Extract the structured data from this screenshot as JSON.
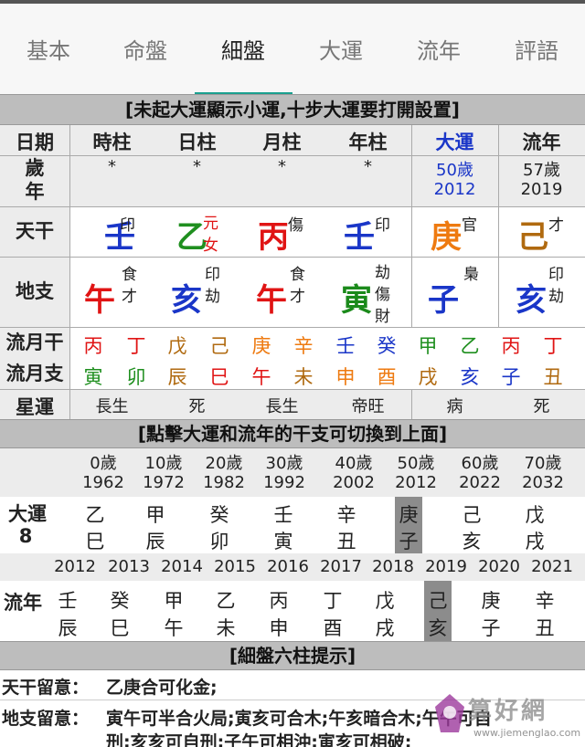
{
  "tabs": [
    "基本",
    "命盤",
    "細盤",
    "大運",
    "流年",
    "評語"
  ],
  "header1": "[未起大運顯示小運,十步大運要打開設置]",
  "columns": {
    "c0": "日期",
    "c1": "時柱",
    "c2": "日柱",
    "c3": "月柱",
    "c4": "年柱",
    "c5": "大運",
    "c6": "流年"
  },
  "age_row": {
    "label": "歲\n年",
    "c1": "*",
    "c2": "*",
    "c3": "*",
    "c4": "*",
    "c5_age": "50歲",
    "c5_year": "2012",
    "c6_age": "57歲",
    "c6_year": "2019"
  },
  "tiangan": {
    "label": "天干",
    "c1": "壬",
    "c1_sup": "印",
    "c2": "乙",
    "c2_sup1": "元",
    "c2_sup2": "女",
    "c3": "丙",
    "c3_sup": "傷",
    "c4": "壬",
    "c4_sup": "印",
    "c5": "庚",
    "c5_sup": "官",
    "c6": "己",
    "c6_sup": "才"
  },
  "dizhi": {
    "label": "地支",
    "c1": "午",
    "c1_a": "食",
    "c1_b": "才",
    "c2": "亥",
    "c2_a": "印",
    "c2_b": "劫",
    "c3": "午",
    "c3_a": "食",
    "c3_b": "才",
    "c4": "寅",
    "c4_a": "劫",
    "c4_b": "傷",
    "c4_c": "財",
    "c5": "子",
    "c5_a": "梟",
    "c6": "亥",
    "c6_a": "印",
    "c6_b": "劫"
  },
  "liuyue_gan": {
    "label": "流月干",
    "items": [
      "丙",
      "丁",
      "戊",
      "己",
      "庚",
      "辛",
      "壬",
      "癸",
      "甲",
      "乙",
      "丙",
      "丁"
    ]
  },
  "liuyue_zhi": {
    "label": "流月支",
    "items": [
      "寅",
      "卯",
      "辰",
      "巳",
      "午",
      "未",
      "申",
      "酉",
      "戌",
      "亥",
      "子",
      "丑"
    ]
  },
  "xingyun": {
    "label": "星運",
    "c1": "長生",
    "c2": "死",
    "c3": "長生",
    "c4": "帝旺",
    "c5": "病",
    "c6": "死"
  },
  "header2": "[點擊大運和流年的干支可切換到上面]",
  "dayun": {
    "ages": [
      "0歲",
      "10歲",
      "20歲",
      "30歲",
      "40歲",
      "50歲",
      "60歲",
      "70歲"
    ],
    "years": [
      "1962",
      "1972",
      "1982",
      "1992",
      "2002",
      "2012",
      "2022",
      "2032"
    ],
    "label1": "大運",
    "label2": "8",
    "gan": [
      "乙",
      "甲",
      "癸",
      "壬",
      "辛",
      "庚",
      "己",
      "戊"
    ],
    "zhi": [
      "巳",
      "辰",
      "卯",
      "寅",
      "丑",
      "子",
      "亥",
      "戌"
    ]
  },
  "liunian": {
    "years": [
      "2012",
      "2013",
      "2014",
      "2015",
      "2016",
      "2017",
      "2018",
      "2019",
      "2020",
      "2021"
    ],
    "label": "流年",
    "gan": [
      "壬",
      "癸",
      "甲",
      "乙",
      "丙",
      "丁",
      "戊",
      "己",
      "庚",
      "辛"
    ],
    "zhi": [
      "辰",
      "巳",
      "午",
      "未",
      "申",
      "酉",
      "戌",
      "亥",
      "子",
      "丑"
    ]
  },
  "header3": "[細盤六柱提示]",
  "notes": {
    "tiangan_label": "天干留意：",
    "tiangan_text": "乙庚合可化金;",
    "dizhi_label": "地支留意：",
    "dizhi_text1": "寅午可半合火局;寅亥可合木;午亥暗合木;午午可自",
    "dizhi_text2": "刑;亥亥可自刑;子午可相沖;寅亥可相破;"
  },
  "watermark": {
    "title": "算好網",
    "url": "www.jiemenglao.com"
  }
}
